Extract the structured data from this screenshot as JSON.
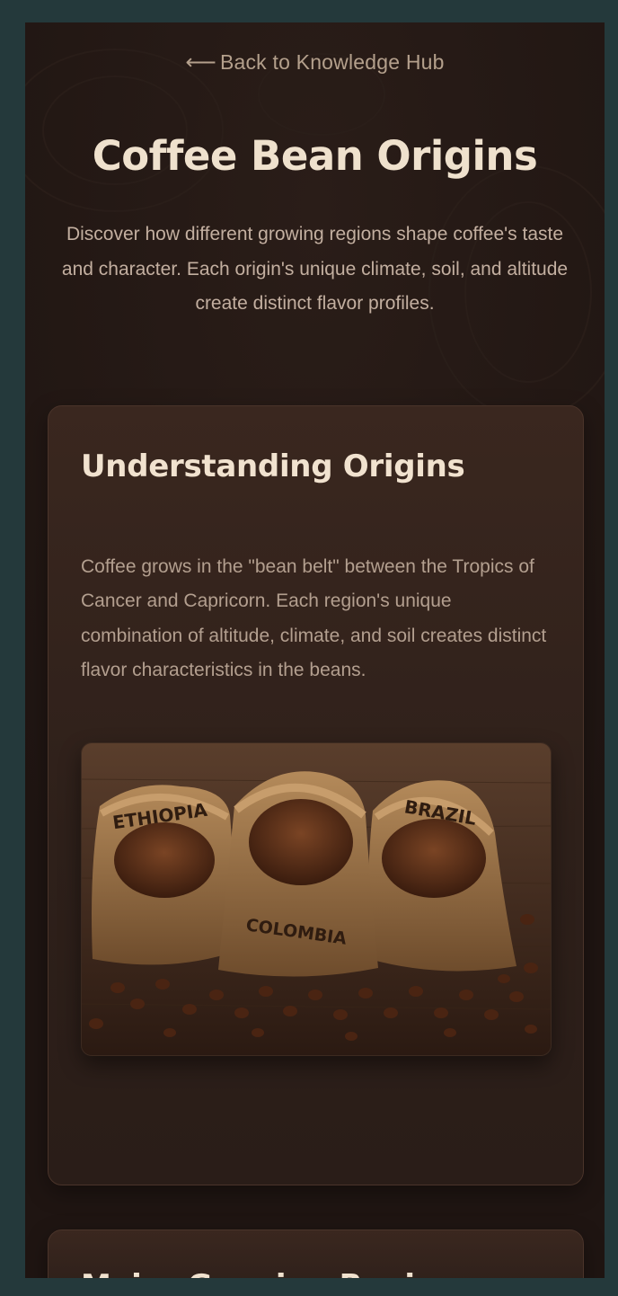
{
  "nav": {
    "back_arrow": "⟵",
    "back_label": "Back to Knowledge Hub"
  },
  "hero": {
    "title": "Coffee Bean Origins",
    "subtitle": "Discover how different growing regions shape coffee's taste and character. Each origin's unique climate, soil, and altitude create distinct flavor profiles."
  },
  "sections": [
    {
      "heading": "Understanding Origins",
      "body": "Coffee grows in the \"bean belt\" between the Tropics of Cancer and Capricorn. Each region's unique combination of altitude, climate, and soil creates distinct flavor characteristics in the beans.",
      "image": {
        "sack_labels": [
          "ETHIOPIA",
          "COLOMBIA",
          "BRAZIL"
        ]
      }
    },
    {
      "heading": "Major Growing Regions"
    }
  ],
  "colors": {
    "page_border": "#24393b",
    "background": "#1f1512",
    "card": "#33231c",
    "heading": "#efe1cd",
    "body_text": "#b39f8f"
  }
}
